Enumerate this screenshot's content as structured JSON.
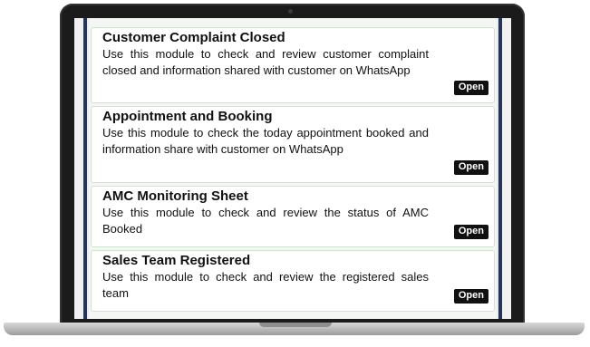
{
  "modules": [
    {
      "title": "Customer Complaint Closed",
      "description": "Use this module to check and review customer complaint closed and information shared with customer on WhatsApp",
      "button": "Open"
    },
    {
      "title": "Appointment and Booking",
      "description": "Use this module to check the today appointment booked and information share with customer on WhatsApp",
      "button": "Open"
    },
    {
      "title": "AMC Monitoring Sheet",
      "description": "Use this module to check and review the status of AMC Booked",
      "button": "Open"
    },
    {
      "title": "Sales Team Registered",
      "description": "Use this module to check and review the registered sales team",
      "button": "Open"
    }
  ],
  "colors": {
    "accent": "#25355a",
    "card_border": "#cfe3cf",
    "button_bg": "#111111",
    "button_text": "#ffffff"
  }
}
